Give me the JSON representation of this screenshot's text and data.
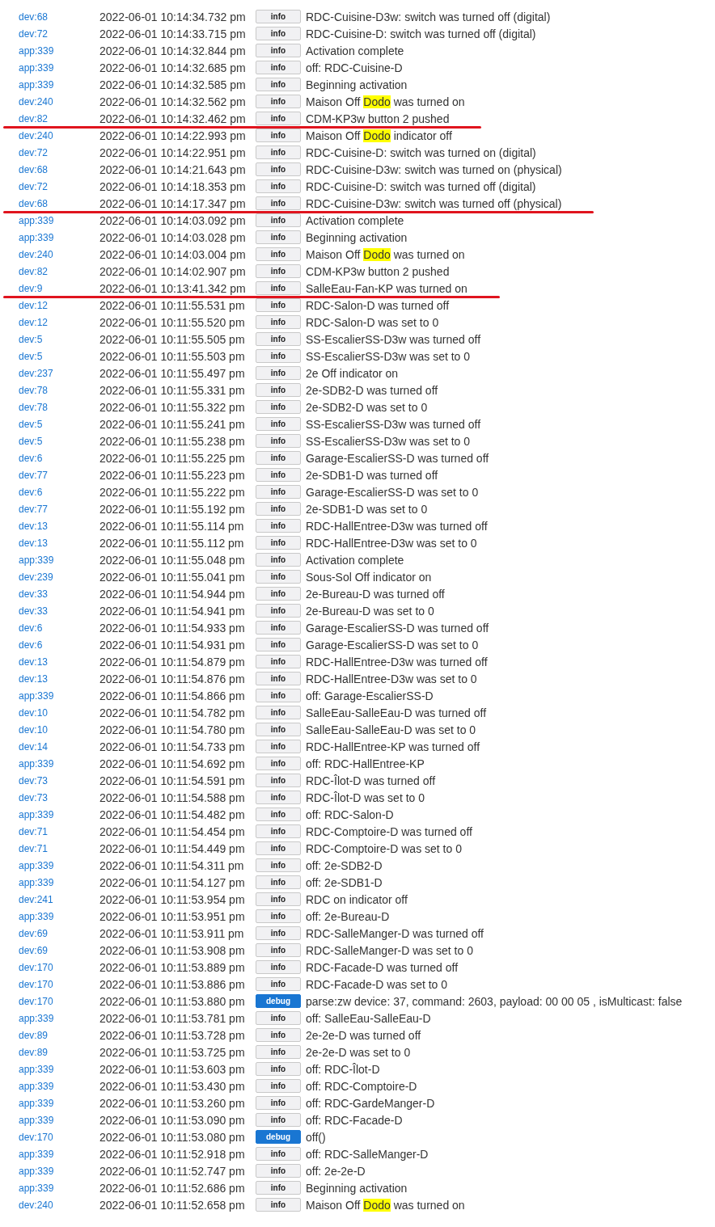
{
  "log_rows": [
    {
      "source": "dev:68",
      "time": "2022-06-01 10:14:34.732 pm",
      "severity": "info",
      "message": "RDC-Cuisine-D3w: switch was turned off (digital)",
      "underlined": false
    },
    {
      "source": "dev:72",
      "time": "2022-06-01 10:14:33.715 pm",
      "severity": "info",
      "message": "RDC-Cuisine-D: switch was turned off (digital)",
      "underlined": false
    },
    {
      "source": "app:339",
      "time": "2022-06-01 10:14:32.844 pm",
      "severity": "info",
      "message": "Activation complete",
      "underlined": false
    },
    {
      "source": "app:339",
      "time": "2022-06-01 10:14:32.685 pm",
      "severity": "info",
      "message": "off: RDC-Cuisine-D",
      "underlined": false
    },
    {
      "source": "app:339",
      "time": "2022-06-01 10:14:32.585 pm",
      "severity": "info",
      "message": "Beginning activation",
      "underlined": false
    },
    {
      "source": "dev:240",
      "time": "2022-06-01 10:14:32.562 pm",
      "severity": "info",
      "message": [
        {
          "text": "Maison Off ",
          "highlighted": false
        },
        {
          "text": "Dodo",
          "highlighted": true
        },
        {
          "text": " was turned on",
          "highlighted": false
        }
      ],
      "underlined": false
    },
    {
      "source": "dev:82",
      "time": "2022-06-01 10:14:32.462 pm",
      "severity": "info",
      "message": "CDM-KP3w button 2 pushed",
      "underlined": true
    },
    {
      "source": "dev:240",
      "time": "2022-06-01 10:14:22.993 pm",
      "severity": "info",
      "message": [
        {
          "text": "Maison Off ",
          "highlighted": false
        },
        {
          "text": "Dodo",
          "highlighted": true
        },
        {
          "text": " indicator off",
          "highlighted": false
        }
      ],
      "underlined": false
    },
    {
      "source": "dev:72",
      "time": "2022-06-01 10:14:22.951 pm",
      "severity": "info",
      "message": "RDC-Cuisine-D: switch was turned on (digital)",
      "underlined": false
    },
    {
      "source": "dev:68",
      "time": "2022-06-01 10:14:21.643 pm",
      "severity": "info",
      "message": "RDC-Cuisine-D3w: switch was turned on (physical)",
      "underlined": false
    },
    {
      "source": "dev:72",
      "time": "2022-06-01 10:14:18.353 pm",
      "severity": "info",
      "message": "RDC-Cuisine-D: switch was turned off (digital)",
      "underlined": false
    },
    {
      "source": "dev:68",
      "time": "2022-06-01 10:14:17.347 pm",
      "severity": "info",
      "message": "RDC-Cuisine-D3w: switch was turned off (physical)",
      "underlined": true
    },
    {
      "source": "app:339",
      "time": "2022-06-01 10:14:03.092 pm",
      "severity": "info",
      "message": "Activation complete",
      "underlined": false
    },
    {
      "source": "app:339",
      "time": "2022-06-01 10:14:03.028 pm",
      "severity": "info",
      "message": "Beginning activation",
      "underlined": false
    },
    {
      "source": "dev:240",
      "time": "2022-06-01 10:14:03.004 pm",
      "severity": "info",
      "message": [
        {
          "text": "Maison Off ",
          "highlighted": false
        },
        {
          "text": "Dodo",
          "highlighted": true
        },
        {
          "text": " was turned on",
          "highlighted": false
        }
      ],
      "underlined": false
    },
    {
      "source": "dev:82",
      "time": "2022-06-01 10:14:02.907 pm",
      "severity": "info",
      "message": "CDM-KP3w button 2 pushed",
      "underlined": false
    },
    {
      "source": "dev:9",
      "time": "2022-06-01 10:13:41.342 pm",
      "severity": "info",
      "message": "SalleEau-Fan-KP was turned on",
      "underlined": true
    },
    {
      "source": "dev:12",
      "time": "2022-06-01 10:11:55.531 pm",
      "severity": "info",
      "message": "RDC-Salon-D was turned off",
      "underlined": false
    },
    {
      "source": "dev:12",
      "time": "2022-06-01 10:11:55.520 pm",
      "severity": "info",
      "message": "RDC-Salon-D was set to 0",
      "underlined": false
    },
    {
      "source": "dev:5",
      "time": "2022-06-01 10:11:55.505 pm",
      "severity": "info",
      "message": "SS-EscalierSS-D3w was turned off",
      "underlined": false
    },
    {
      "source": "dev:5",
      "time": "2022-06-01 10:11:55.503 pm",
      "severity": "info",
      "message": "SS-EscalierSS-D3w was set to 0",
      "underlined": false
    },
    {
      "source": "dev:237",
      "time": "2022-06-01 10:11:55.497 pm",
      "severity": "info",
      "message": "2e Off indicator on",
      "underlined": false
    },
    {
      "source": "dev:78",
      "time": "2022-06-01 10:11:55.331 pm",
      "severity": "info",
      "message": "2e-SDB2-D was turned off",
      "underlined": false
    },
    {
      "source": "dev:78",
      "time": "2022-06-01 10:11:55.322 pm",
      "severity": "info",
      "message": "2e-SDB2-D was set to 0",
      "underlined": false
    },
    {
      "source": "dev:5",
      "time": "2022-06-01 10:11:55.241 pm",
      "severity": "info",
      "message": "SS-EscalierSS-D3w was turned off",
      "underlined": false
    },
    {
      "source": "dev:5",
      "time": "2022-06-01 10:11:55.238 pm",
      "severity": "info",
      "message": "SS-EscalierSS-D3w was set to 0",
      "underlined": false
    },
    {
      "source": "dev:6",
      "time": "2022-06-01 10:11:55.225 pm",
      "severity": "info",
      "message": "Garage-EscalierSS-D was turned off",
      "underlined": false
    },
    {
      "source": "dev:77",
      "time": "2022-06-01 10:11:55.223 pm",
      "severity": "info",
      "message": "2e-SDB1-D was turned off",
      "underlined": false
    },
    {
      "source": "dev:6",
      "time": "2022-06-01 10:11:55.222 pm",
      "severity": "info",
      "message": "Garage-EscalierSS-D was set to 0",
      "underlined": false
    },
    {
      "source": "dev:77",
      "time": "2022-06-01 10:11:55.192 pm",
      "severity": "info",
      "message": "2e-SDB1-D was set to 0",
      "underlined": false
    },
    {
      "source": "dev:13",
      "time": "2022-06-01 10:11:55.114 pm",
      "severity": "info",
      "message": "RDC-HallEntree-D3w was turned off",
      "underlined": false
    },
    {
      "source": "dev:13",
      "time": "2022-06-01 10:11:55.112 pm",
      "severity": "info",
      "message": "RDC-HallEntree-D3w was set to 0",
      "underlined": false
    },
    {
      "source": "app:339",
      "time": "2022-06-01 10:11:55.048 pm",
      "severity": "info",
      "message": "Activation complete",
      "underlined": false
    },
    {
      "source": "dev:239",
      "time": "2022-06-01 10:11:55.041 pm",
      "severity": "info",
      "message": "Sous-Sol Off indicator on",
      "underlined": false
    },
    {
      "source": "dev:33",
      "time": "2022-06-01 10:11:54.944 pm",
      "severity": "info",
      "message": "2e-Bureau-D was turned off",
      "underlined": false
    },
    {
      "source": "dev:33",
      "time": "2022-06-01 10:11:54.941 pm",
      "severity": "info",
      "message": "2e-Bureau-D was set to 0",
      "underlined": false
    },
    {
      "source": "dev:6",
      "time": "2022-06-01 10:11:54.933 pm",
      "severity": "info",
      "message": "Garage-EscalierSS-D was turned off",
      "underlined": false
    },
    {
      "source": "dev:6",
      "time": "2022-06-01 10:11:54.931 pm",
      "severity": "info",
      "message": "Garage-EscalierSS-D was set to 0",
      "underlined": false
    },
    {
      "source": "dev:13",
      "time": "2022-06-01 10:11:54.879 pm",
      "severity": "info",
      "message": "RDC-HallEntree-D3w was turned off",
      "underlined": false
    },
    {
      "source": "dev:13",
      "time": "2022-06-01 10:11:54.876 pm",
      "severity": "info",
      "message": "RDC-HallEntree-D3w was set to 0",
      "underlined": false
    },
    {
      "source": "app:339",
      "time": "2022-06-01 10:11:54.866 pm",
      "severity": "info",
      "message": "off: Garage-EscalierSS-D",
      "underlined": false
    },
    {
      "source": "dev:10",
      "time": "2022-06-01 10:11:54.782 pm",
      "severity": "info",
      "message": "SalleEau-SalleEau-D was turned off",
      "underlined": false
    },
    {
      "source": "dev:10",
      "time": "2022-06-01 10:11:54.780 pm",
      "severity": "info",
      "message": "SalleEau-SalleEau-D was set to 0",
      "underlined": false
    },
    {
      "source": "dev:14",
      "time": "2022-06-01 10:11:54.733 pm",
      "severity": "info",
      "message": "RDC-HallEntree-KP was turned off",
      "underlined": false
    },
    {
      "source": "app:339",
      "time": "2022-06-01 10:11:54.692 pm",
      "severity": "info",
      "message": "off: RDC-HallEntree-KP",
      "underlined": false
    },
    {
      "source": "dev:73",
      "time": "2022-06-01 10:11:54.591 pm",
      "severity": "info",
      "message": "RDC-Îlot-D was turned off",
      "underlined": false
    },
    {
      "source": "dev:73",
      "time": "2022-06-01 10:11:54.588 pm",
      "severity": "info",
      "message": "RDC-Îlot-D was set to 0",
      "underlined": false
    },
    {
      "source": "app:339",
      "time": "2022-06-01 10:11:54.482 pm",
      "severity": "info",
      "message": "off: RDC-Salon-D",
      "underlined": false
    },
    {
      "source": "dev:71",
      "time": "2022-06-01 10:11:54.454 pm",
      "severity": "info",
      "message": "RDC-Comptoire-D was turned off",
      "underlined": false
    },
    {
      "source": "dev:71",
      "time": "2022-06-01 10:11:54.449 pm",
      "severity": "info",
      "message": "RDC-Comptoire-D was set to 0",
      "underlined": false
    },
    {
      "source": "app:339",
      "time": "2022-06-01 10:11:54.311 pm",
      "severity": "info",
      "message": "off: 2e-SDB2-D",
      "underlined": false
    },
    {
      "source": "app:339",
      "time": "2022-06-01 10:11:54.127 pm",
      "severity": "info",
      "message": "off: 2e-SDB1-D",
      "underlined": false
    },
    {
      "source": "dev:241",
      "time": "2022-06-01 10:11:53.954 pm",
      "severity": "info",
      "message": "RDC on indicator off",
      "underlined": false
    },
    {
      "source": "app:339",
      "time": "2022-06-01 10:11:53.951 pm",
      "severity": "info",
      "message": "off: 2e-Bureau-D",
      "underlined": false
    },
    {
      "source": "dev:69",
      "time": "2022-06-01 10:11:53.911 pm",
      "severity": "info",
      "message": "RDC-SalleManger-D was turned off",
      "underlined": false
    },
    {
      "source": "dev:69",
      "time": "2022-06-01 10:11:53.908 pm",
      "severity": "info",
      "message": "RDC-SalleManger-D was set to 0",
      "underlined": false
    },
    {
      "source": "dev:170",
      "time": "2022-06-01 10:11:53.889 pm",
      "severity": "info",
      "message": "RDC-Facade-D was turned off",
      "underlined": false
    },
    {
      "source": "dev:170",
      "time": "2022-06-01 10:11:53.886 pm",
      "severity": "info",
      "message": "RDC-Facade-D was set to 0",
      "underlined": false
    },
    {
      "source": "dev:170",
      "time": "2022-06-01 10:11:53.880 pm",
      "severity": "debug",
      "message": "parse:zw device: 37, command: 2603, payload: 00 00 05 , isMulticast: false",
      "underlined": false
    },
    {
      "source": "app:339",
      "time": "2022-06-01 10:11:53.781 pm",
      "severity": "info",
      "message": "off: SalleEau-SalleEau-D",
      "underlined": false
    },
    {
      "source": "dev:89",
      "time": "2022-06-01 10:11:53.728 pm",
      "severity": "info",
      "message": "2e-2e-D was turned off",
      "underlined": false
    },
    {
      "source": "dev:89",
      "time": "2022-06-01 10:11:53.725 pm",
      "severity": "info",
      "message": "2e-2e-D was set to 0",
      "underlined": false
    },
    {
      "source": "app:339",
      "time": "2022-06-01 10:11:53.603 pm",
      "severity": "info",
      "message": "off: RDC-Îlot-D",
      "underlined": false
    },
    {
      "source": "app:339",
      "time": "2022-06-01 10:11:53.430 pm",
      "severity": "info",
      "message": "off: RDC-Comptoire-D",
      "underlined": false
    },
    {
      "source": "app:339",
      "time": "2022-06-01 10:11:53.260 pm",
      "severity": "info",
      "message": "off: RDC-GardeManger-D",
      "underlined": false
    },
    {
      "source": "app:339",
      "time": "2022-06-01 10:11:53.090 pm",
      "severity": "info",
      "message": "off: RDC-Facade-D",
      "underlined": false
    },
    {
      "source": "dev:170",
      "time": "2022-06-01 10:11:53.080 pm",
      "severity": "debug",
      "message": "off()",
      "underlined": false
    },
    {
      "source": "app:339",
      "time": "2022-06-01 10:11:52.918 pm",
      "severity": "info",
      "message": "off: RDC-SalleManger-D",
      "underlined": false
    },
    {
      "source": "app:339",
      "time": "2022-06-01 10:11:52.747 pm",
      "severity": "info",
      "message": "off: 2e-2e-D",
      "underlined": false
    },
    {
      "source": "app:339",
      "time": "2022-06-01 10:11:52.686 pm",
      "severity": "info",
      "message": "Beginning activation",
      "underlined": false
    },
    {
      "source": "dev:240",
      "time": "2022-06-01 10:11:52.658 pm",
      "severity": "info",
      "message": [
        {
          "text": "Maison Off ",
          "highlighted": false
        },
        {
          "text": "Dodo",
          "highlighted": true
        },
        {
          "text": " was turned on",
          "highlighted": false
        }
      ],
      "underlined": false
    }
  ]
}
